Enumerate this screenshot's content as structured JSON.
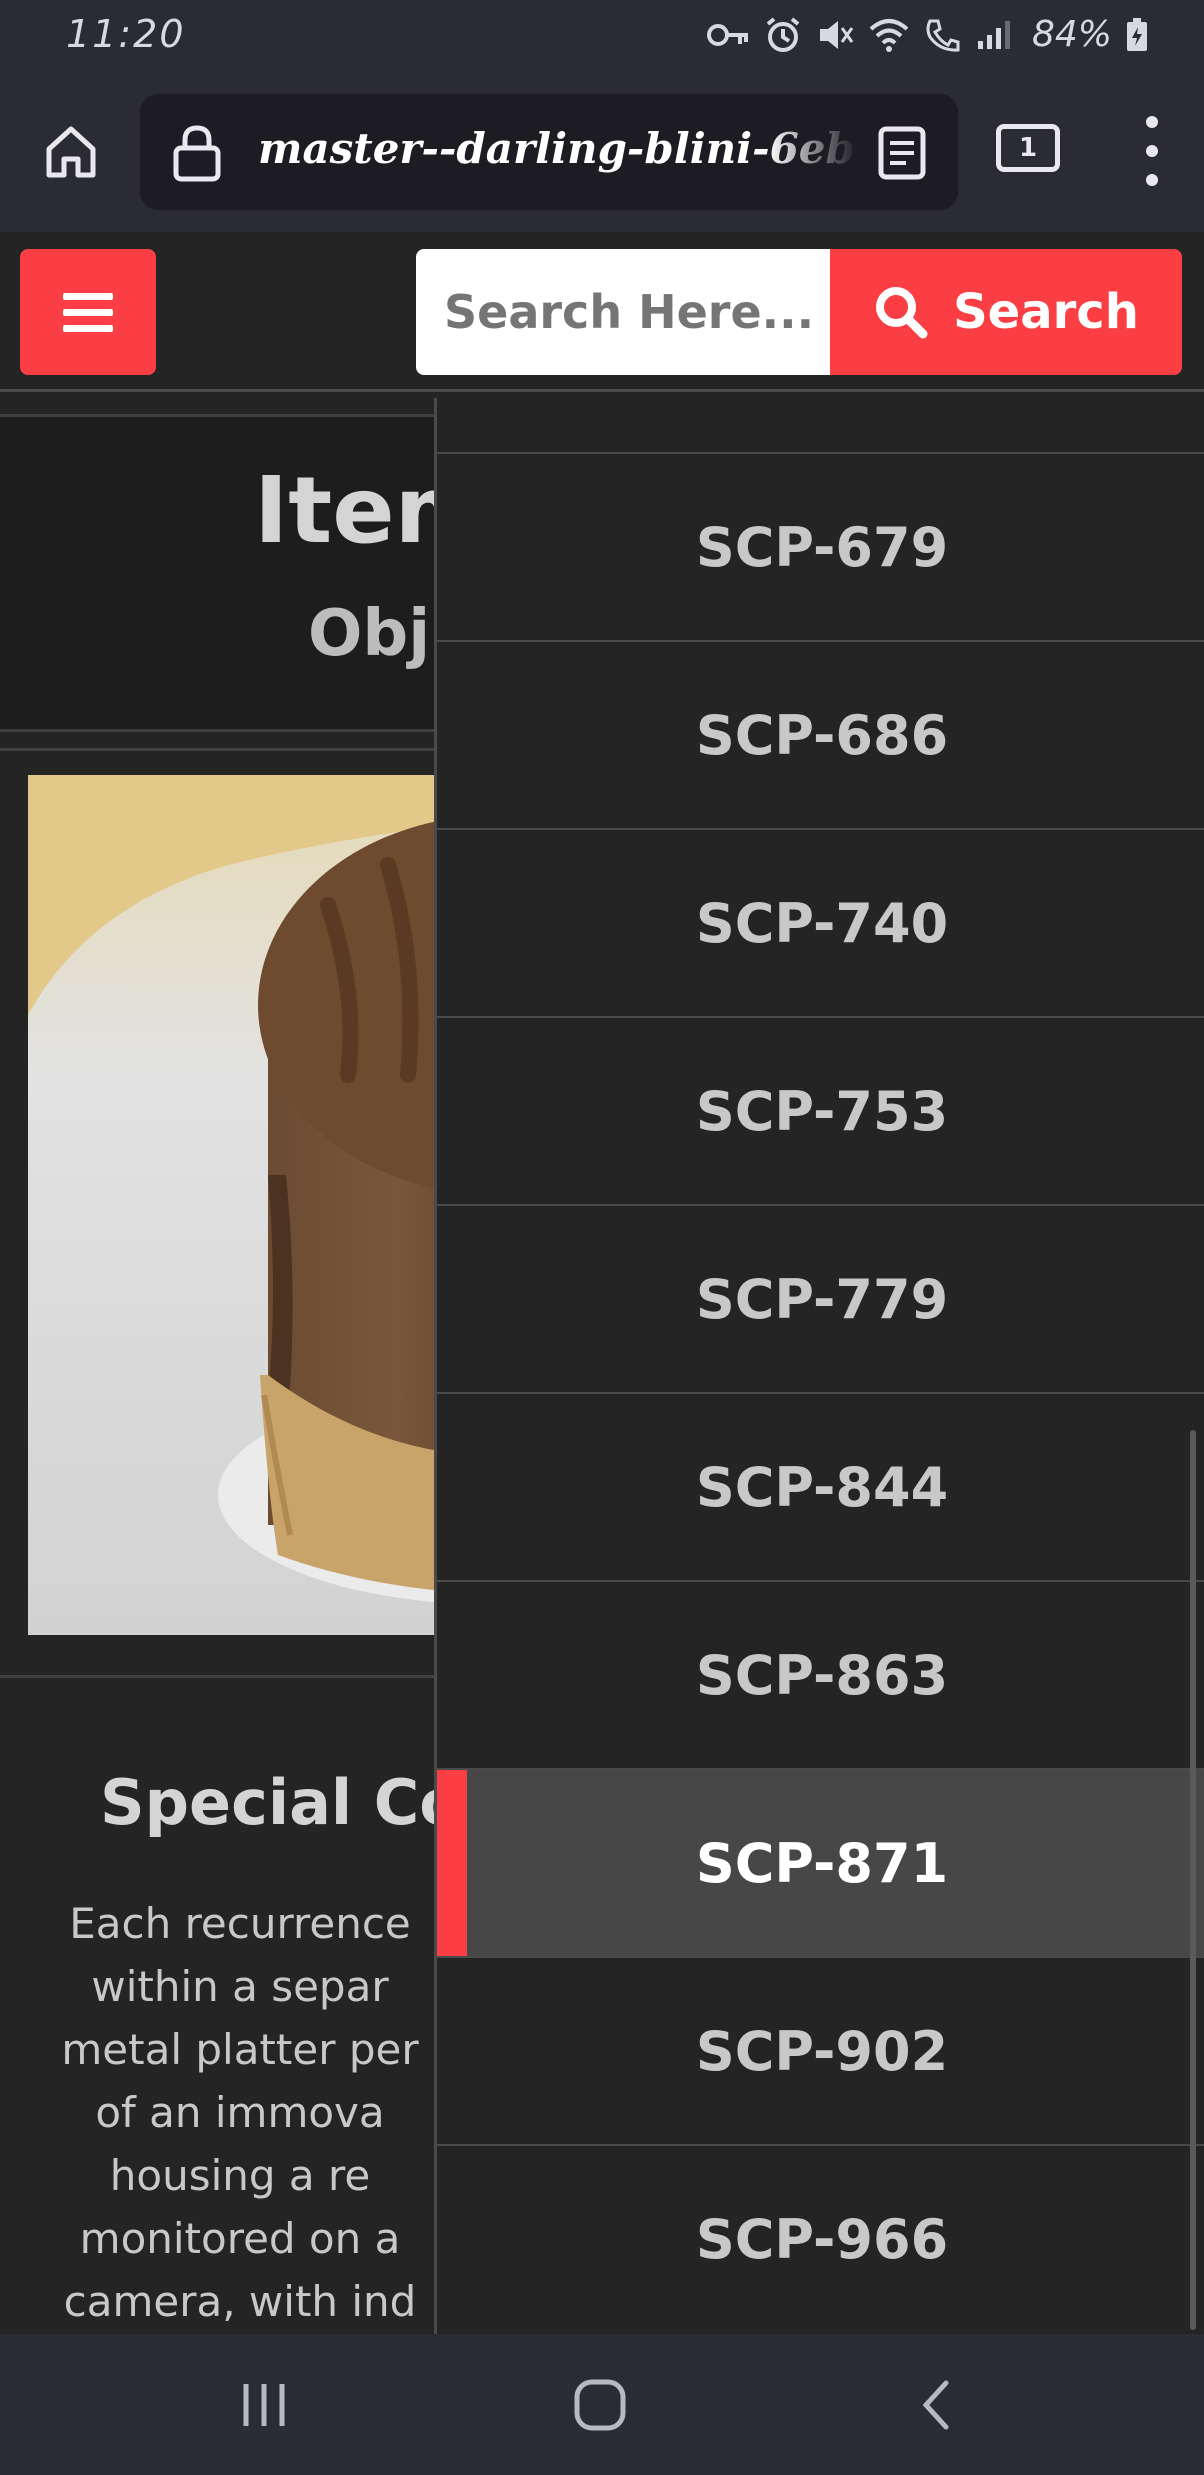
{
  "status_bar": {
    "time": "11:20",
    "battery": "84%"
  },
  "browser": {
    "url": "master--darling-blini-6eb",
    "tab_count": "1"
  },
  "header": {
    "search_placeholder": "Search Here...",
    "search_button": "Search",
    "accent_color": "#fb3e44"
  },
  "main": {
    "item_title": "Item",
    "object_class": "Obj",
    "special_title": "Special Co",
    "special_lines": [
      "Each recurrence",
      "within a separ",
      "metal platter per",
      "of an immova",
      "housing a re",
      "monitored on a",
      "camera, with ind"
    ]
  },
  "drawer": {
    "items": [
      {
        "label": "SCP-679",
        "active": false
      },
      {
        "label": "SCP-686",
        "active": false
      },
      {
        "label": "SCP-740",
        "active": false
      },
      {
        "label": "SCP-753",
        "active": false
      },
      {
        "label": "SCP-779",
        "active": false
      },
      {
        "label": "SCP-844",
        "active": false
      },
      {
        "label": "SCP-863",
        "active": false
      },
      {
        "label": "SCP-871",
        "active": true
      },
      {
        "label": "SCP-902",
        "active": false
      },
      {
        "label": "SCP-966",
        "active": false
      }
    ]
  }
}
